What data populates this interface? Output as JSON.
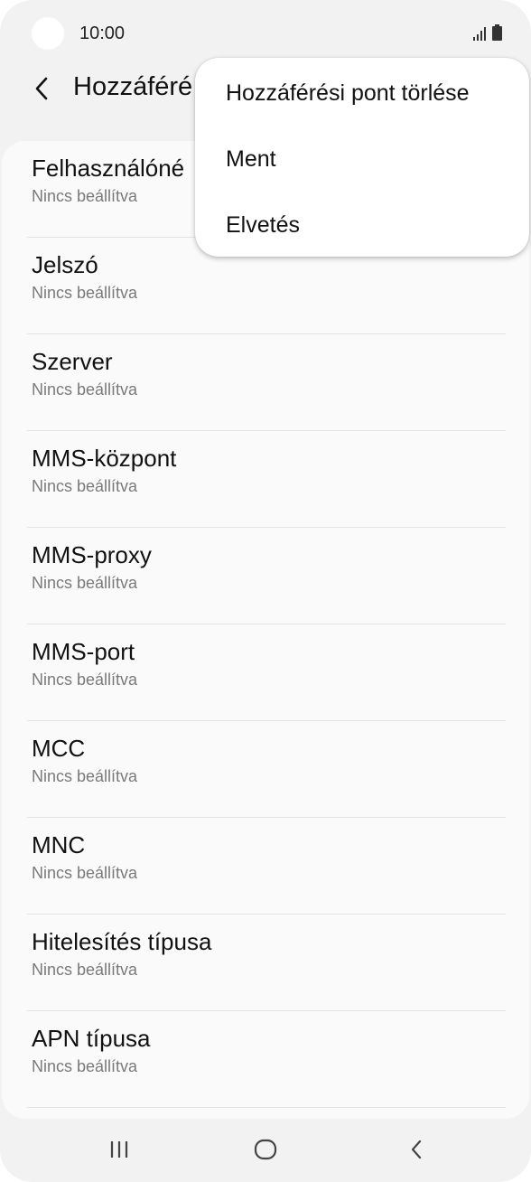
{
  "status_bar": {
    "time": "10:00"
  },
  "header": {
    "title": "Hozzáféré"
  },
  "fields": [
    {
      "label": "Felhasználóné",
      "value": "Nincs beállítva"
    },
    {
      "label": "Jelszó",
      "value": "Nincs beállítva"
    },
    {
      "label": "Szerver",
      "value": "Nincs beállítva"
    },
    {
      "label": "MMS-központ",
      "value": "Nincs beállítva"
    },
    {
      "label": "MMS-proxy",
      "value": "Nincs beállítva"
    },
    {
      "label": "MMS-port",
      "value": "Nincs beállítva"
    },
    {
      "label": "MCC",
      "value": "Nincs beállítva"
    },
    {
      "label": "MNC",
      "value": "Nincs beállítva"
    },
    {
      "label": "Hitelesítés típusa",
      "value": "Nincs beállítva"
    },
    {
      "label": "APN típusa",
      "value": "Nincs beállítva"
    }
  ],
  "menu": {
    "items": [
      {
        "label": "Hozzáférési pont törlése"
      },
      {
        "label": "Ment"
      },
      {
        "label": "Elvetés"
      }
    ]
  },
  "navigation": {
    "recents_icon": "recents-icon",
    "home_icon": "home-icon",
    "back_icon": "back-icon"
  },
  "colors": {
    "background": "#f2f2f2",
    "card": "#fafafa",
    "secondary_text": "#7a7a7a"
  }
}
